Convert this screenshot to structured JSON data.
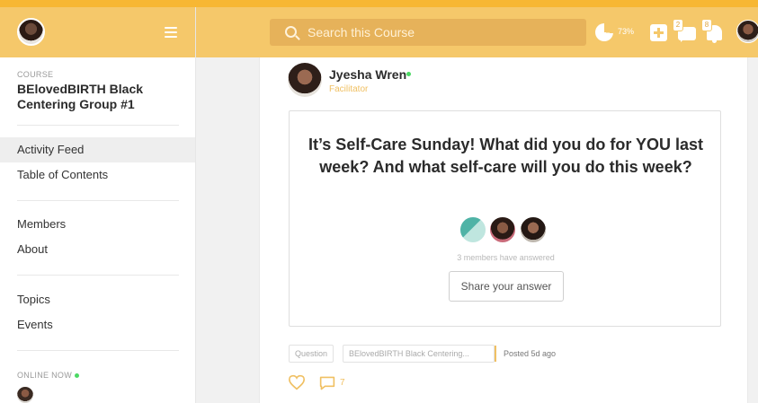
{
  "sidebar": {
    "course_label": "COURSE",
    "course_name": "BElovedBIRTH Black Centering Group #1",
    "nav": [
      {
        "label": "Activity Feed",
        "active": true
      },
      {
        "label": "Table of Contents"
      },
      {
        "label": "Members"
      },
      {
        "label": "About"
      },
      {
        "label": "Topics"
      },
      {
        "label": "Events"
      }
    ],
    "online_label": "ONLINE NOW"
  },
  "header": {
    "search_placeholder": "Search this Course",
    "progress": "73%",
    "chat_badge": "2",
    "notification_badge": "8"
  },
  "post": {
    "author_name": "Jyesha Wren",
    "author_role": "Facilitator",
    "question": "It’s Self-Care Sunday! What did you do for YOU last week? And what self-care will you do this week?",
    "answered_text": "3 members have answered",
    "share_button": "Share your answer",
    "tag_type": "Question",
    "tag_space": "BElovedBIRTH Black Centering...",
    "posted": "Posted 5d ago",
    "comment_count": "7"
  },
  "colors": {
    "brand": "#f5c86a",
    "online": "#4cd964",
    "accent_text": "#f0c063"
  }
}
